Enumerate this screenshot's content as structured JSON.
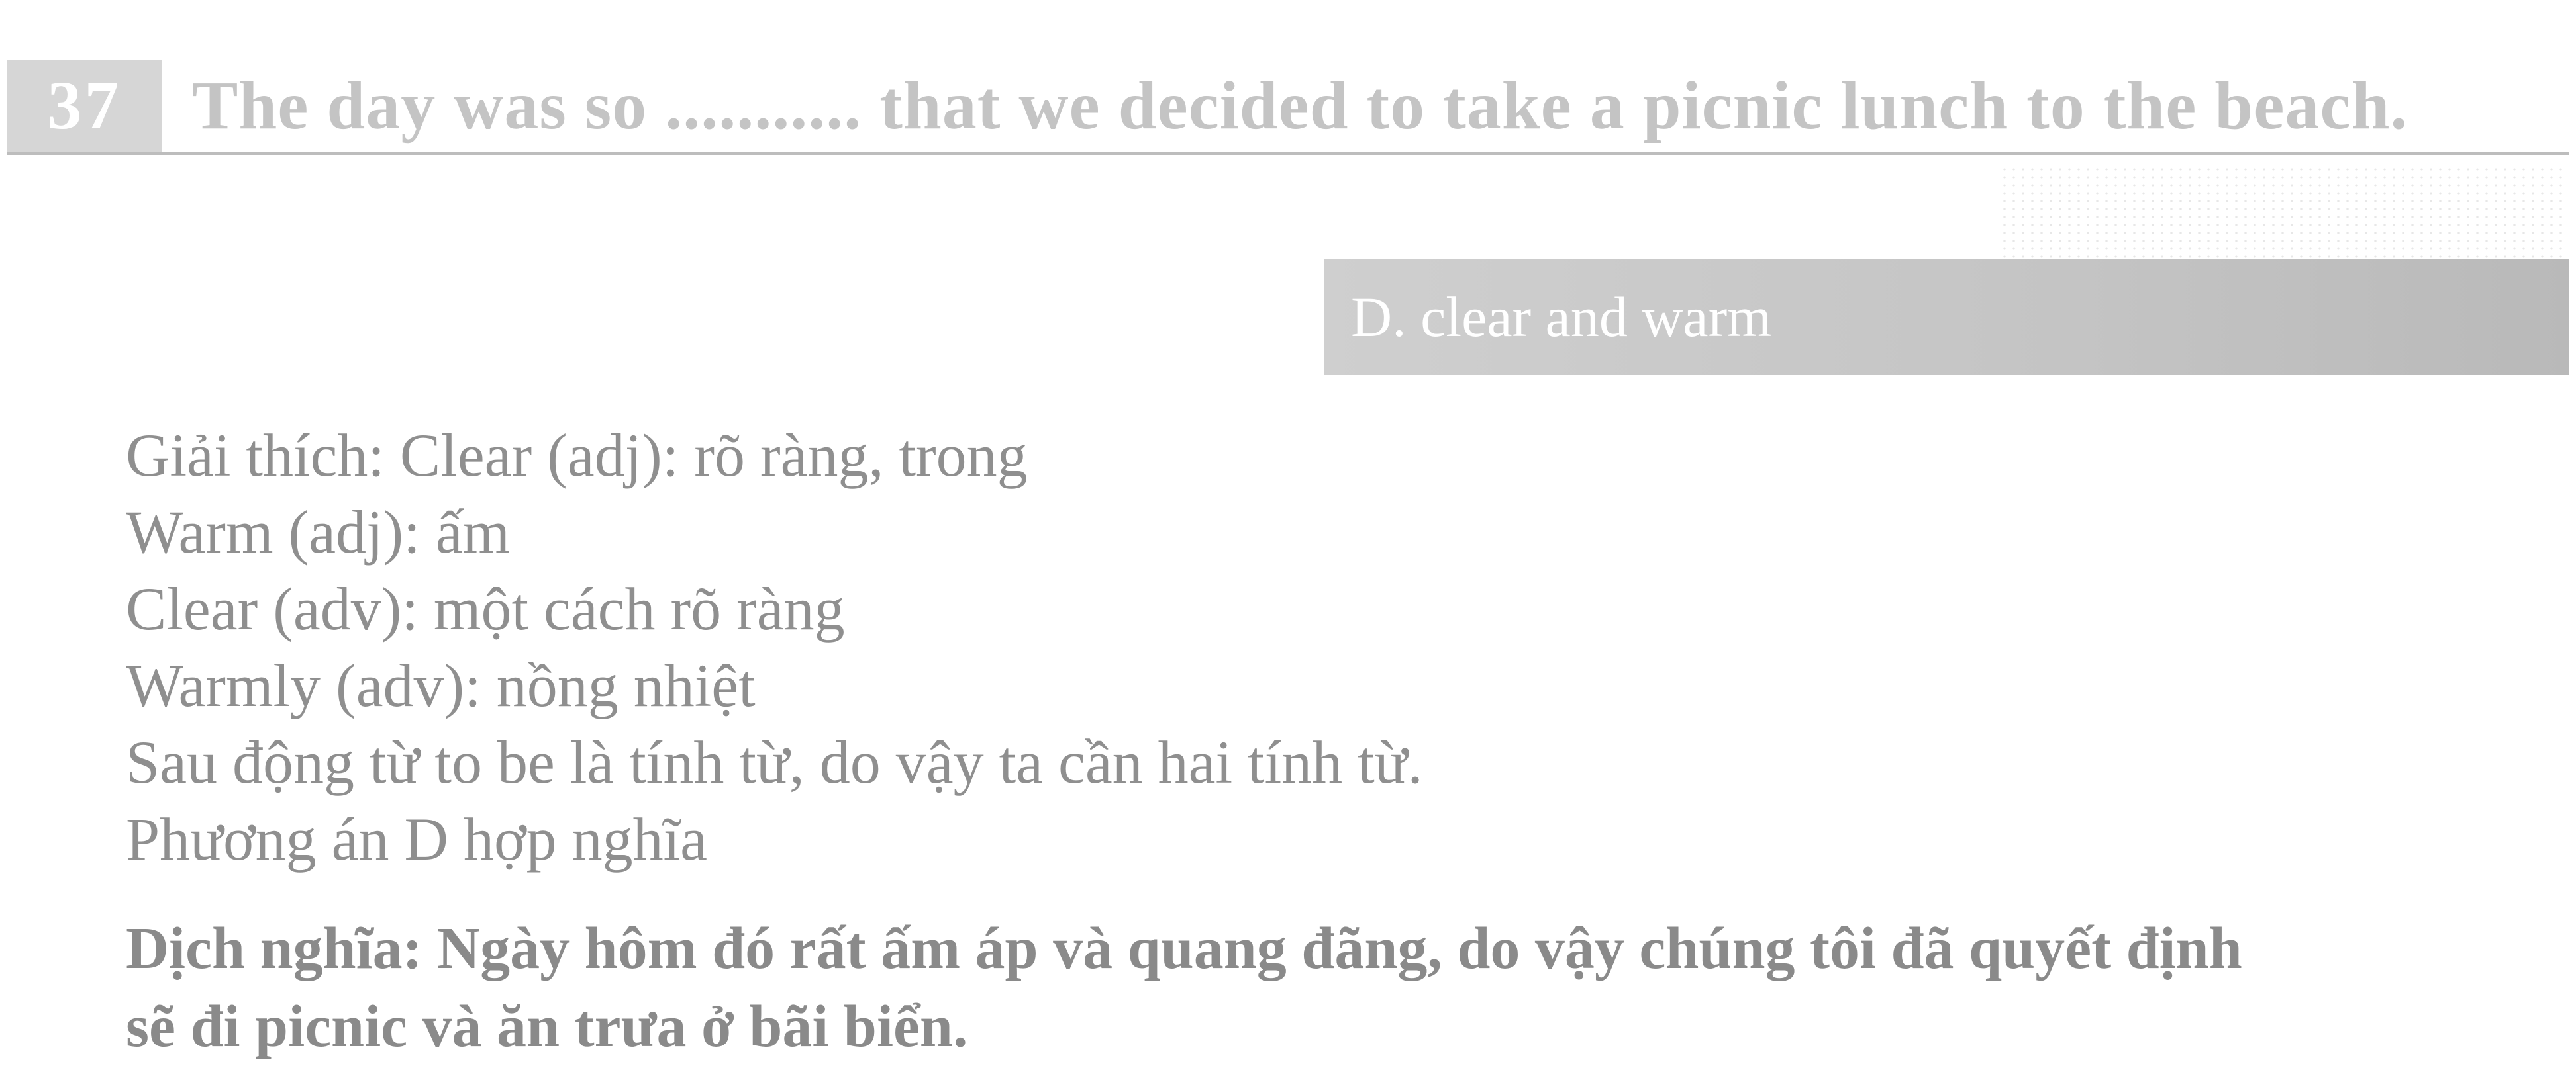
{
  "question": {
    "number": "37",
    "text": "The day was so ........... that we decided to take a picnic lunch to the beach."
  },
  "answer": {
    "label": "D. clear and warm"
  },
  "explanation": {
    "lines": [
      "Giải thích: Clear (adj): rõ ràng, trong",
      "Warm (adj): ấm",
      "Clear (adv): một cách rõ ràng",
      "Warmly (adv): nồng nhiệt",
      "Sau động từ to be là tính từ, do vậy ta cần hai tính từ.",
      "Phương án D hợp nghĩa"
    ]
  },
  "translation": {
    "lines": [
      "Dịch nghĩa: Ngày hôm đó rất ấm áp và quang đãng, do vậy chúng tôi đã quyết định",
      "sẽ đi picnic và ăn trưa ở bãi biển."
    ]
  }
}
